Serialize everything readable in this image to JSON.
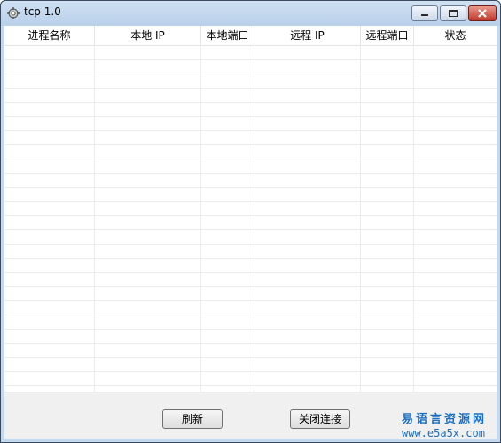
{
  "window": {
    "title": "tcp 1.0"
  },
  "table": {
    "columns": [
      "进程名称",
      "本地 IP",
      "本地端口",
      "远程 IP",
      "远程端口",
      "状态"
    ]
  },
  "buttons": {
    "refresh": "刷新",
    "close_connection": "关闭连接"
  },
  "watermark": {
    "line1": "易语言资源网",
    "line2": "www.e5a5x.com"
  },
  "colors": {
    "accent": "#1a6fc4",
    "close_button": "#c0392b"
  }
}
